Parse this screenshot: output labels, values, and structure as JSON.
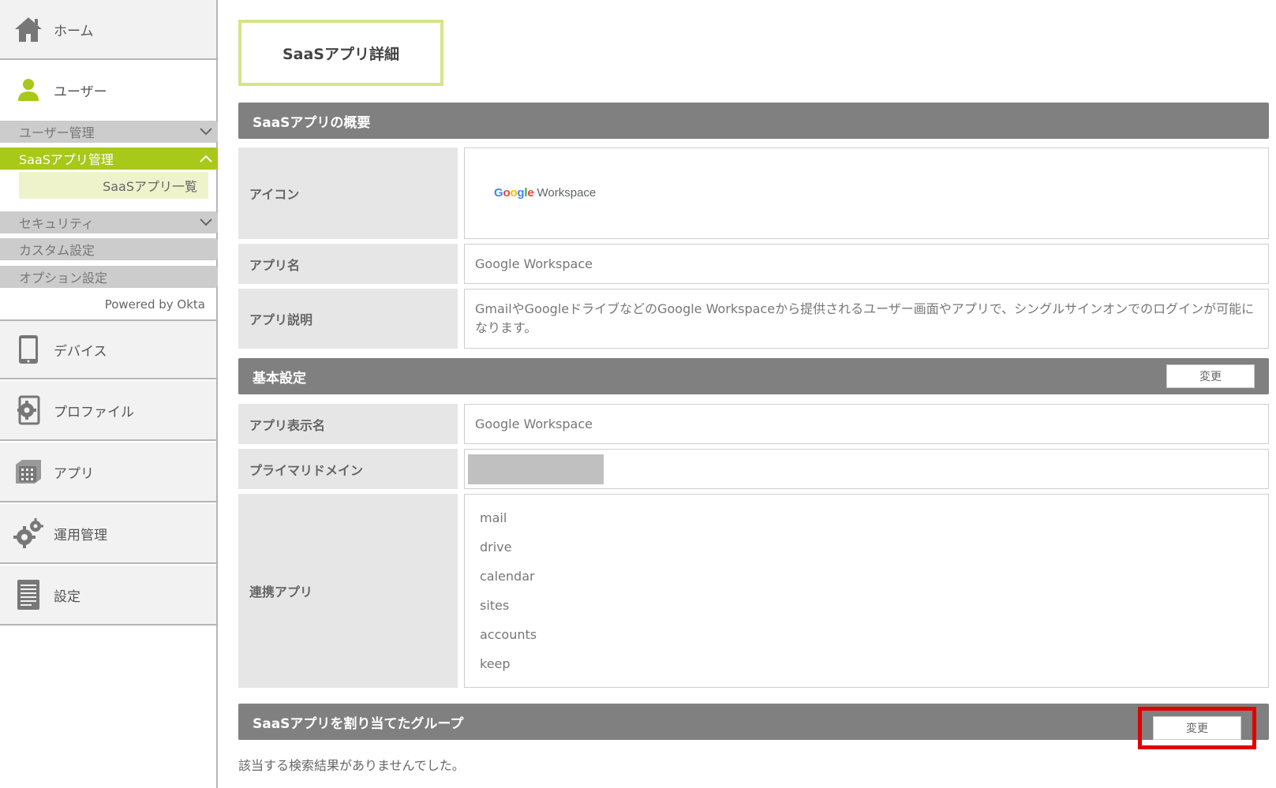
{
  "sidebar": {
    "home": "ホーム",
    "user": "ユーザー",
    "sub_items": {
      "user_management": "ユーザー管理",
      "saas_management": "SaaSアプリ管理",
      "saas_list": "SaaSアプリ一覧",
      "security": "セキュリティ",
      "custom_settings": "カスタム設定",
      "option_settings": "オプション設定"
    },
    "powered_by": "Powered by Okta",
    "device": "デバイス",
    "profile": "プロファイル",
    "app": "アプリ",
    "operations": "運用管理",
    "settings": "設定"
  },
  "main": {
    "page_title": "SaaSアプリ詳細",
    "overview": {
      "heading": "SaaSアプリの概要",
      "icon_label": "アイコン",
      "logo_google": "Google",
      "logo_workspace": "Workspace",
      "app_name_label": "アプリ名",
      "app_name_value": "Google Workspace",
      "app_desc_label": "アプリ説明",
      "app_desc_value": "GmailやGoogleドライブなどのGoogle Workspaceから提供されるユーザー画面やアプリで、シングルサインオンでのログインが可能になります。"
    },
    "basic": {
      "heading": "基本設定",
      "change_label": "変更",
      "display_name_label": "アプリ表示名",
      "display_name_value": "Google Workspace",
      "primary_domain_label": "プライマリドメイン",
      "linked_apps_label": "連携アプリ",
      "linked_apps": [
        "mail",
        "drive",
        "calendar",
        "sites",
        "accounts",
        "keep"
      ]
    },
    "groups": {
      "heading": "SaaSアプリを割り当てたグループ",
      "change_label": "変更",
      "empty_message": "該当する検索結果がありませんでした。"
    }
  },
  "colors": {
    "accent": "#a8c81a",
    "section_bar": "#808080",
    "highlight": "#e00000",
    "title_border": "#d4e48a"
  }
}
